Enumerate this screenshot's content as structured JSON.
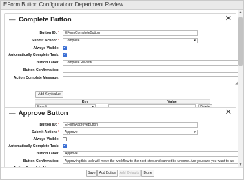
{
  "window": {
    "title": "EForm Button Configuration: Department Review"
  },
  "labels": {
    "button_id": "Button ID:",
    "submit_action": "Submit Action:",
    "always_visible": "Always Visible:",
    "auto_complete": "Automatically Complete Task:",
    "button_label": "Button Label:",
    "button_confirmation": "Button Confirmation:",
    "action_complete_message": "Action Complete Message:",
    "required_mark": "*"
  },
  "sections": [
    {
      "title": "Complete Button",
      "button_id": "EFormCompleteButton",
      "submit_action": "Complete",
      "always_visible": true,
      "auto_complete": true,
      "button_label": "Complete Review",
      "button_confirmation": "",
      "add_key_value": "Add Key/Value",
      "kv_columns": {
        "key": "Key",
        "value": "Value"
      },
      "kv_row": {
        "key": "Result",
        "value": "",
        "delete": "Delete"
      }
    },
    {
      "title": "Approve Button",
      "button_id": "EFormApproveButton",
      "submit_action": "Approve",
      "always_visible": false,
      "auto_complete": true,
      "button_label": "Approve",
      "button_confirmation": "Approving this task will move the workflow to the next step and cannot be undone. Are you sure you want to ap"
    }
  ],
  "footer": {
    "save": "Save",
    "add_button": "Add Button",
    "add_defaults": "Add Defaults",
    "done": "Done"
  },
  "icons": {
    "close": "close-icon",
    "collapse": "collapse-icon",
    "dropdown": "chevron-down-icon",
    "checkbox_checked_color": "#3b6fd4"
  }
}
